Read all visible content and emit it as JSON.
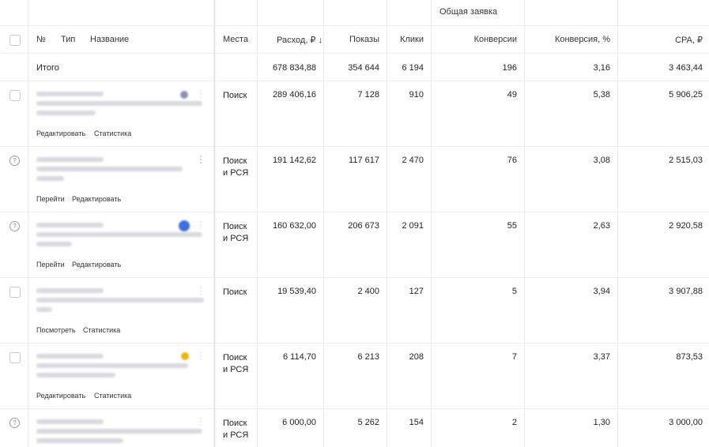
{
  "group_header": "Общая заявка",
  "columns": {
    "num": "№",
    "type": "Тип",
    "name": "Название",
    "places": "Места",
    "expense": "Расход, ₽ ↓",
    "impressions": "Показы",
    "clicks": "Клики",
    "conversions": "Конверсии",
    "conv_rate": "Конверсия, %",
    "cpa": "CPA, ₽"
  },
  "total": {
    "label": "Итого",
    "expense": "678 834,88",
    "impressions": "354 644",
    "clicks": "6 194",
    "conversions": "196",
    "conv_rate": "3,16",
    "cpa": "3 463,44"
  },
  "rows": [
    {
      "place1": "Поиск",
      "place2": "",
      "expense": "289 406,16",
      "impressions": "7 128",
      "clicks": "910",
      "conversions": "49",
      "conv_rate": "5,38",
      "cpa": "5 906,25",
      "link1": "Редактировать",
      "link2": "Статистика",
      "badge": "#8b93b8"
    },
    {
      "place1": "Поиск",
      "place2": "и РСЯ",
      "expense": "191 142,62",
      "impressions": "117 617",
      "clicks": "2 470",
      "conversions": "76",
      "conv_rate": "3,08",
      "cpa": "2 515,03",
      "link1": "Перейти",
      "link2": "Редактировать",
      "badge": ""
    },
    {
      "place1": "Поиск",
      "place2": "и РСЯ",
      "expense": "160 632,00",
      "impressions": "206 673",
      "clicks": "2 091",
      "conversions": "55",
      "conv_rate": "2,63",
      "cpa": "2 920,58",
      "link1": "Перейти",
      "link2": "Редактировать",
      "badge": "#3d6fe0"
    },
    {
      "place1": "Поиск",
      "place2": "",
      "expense": "19 539,40",
      "impressions": "2 400",
      "clicks": "127",
      "conversions": "5",
      "conv_rate": "3,94",
      "cpa": "3 907,88",
      "link1": "Посмотреть",
      "link2": "Статистика",
      "badge": ""
    },
    {
      "place1": "Поиск",
      "place2": "и РСЯ",
      "expense": "6 114,70",
      "impressions": "6 213",
      "clicks": "208",
      "conversions": "7",
      "conv_rate": "3,37",
      "cpa": "873,53",
      "link1": "Редактировать",
      "link2": "Статистика",
      "badge": "#f0b400"
    },
    {
      "place1": "Поиск",
      "place2": "и РСЯ",
      "expense": "6 000,00",
      "impressions": "5 262",
      "clicks": "154",
      "conversions": "2",
      "conv_rate": "1,30",
      "cpa": "3 000,00",
      "link1": "",
      "link2": "",
      "badge": ""
    }
  ]
}
